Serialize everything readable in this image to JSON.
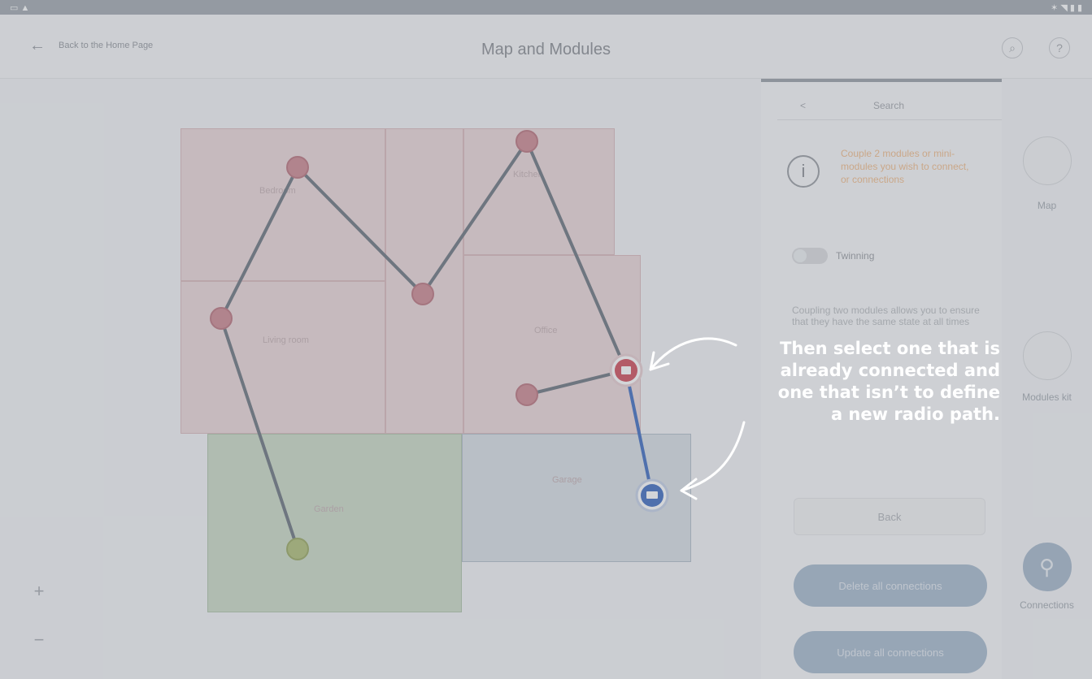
{
  "header": {
    "back_label": "Back to the Home Page",
    "title": "Map and Modules",
    "help_icon": "question-icon",
    "search_icon": "magnifier-icon"
  },
  "panel": {
    "tab_label": "Search",
    "tab_chevron": "<",
    "info_icon": "i",
    "warning_text": "Couple 2 modules or mini-modules you wish to connect, or connections",
    "toggle_label": "Twinning",
    "coupling_text": "Coupling two modules allows you to ensure that they have the same state at all times",
    "back_button": "Back",
    "delete_all_button": "Delete all connections",
    "update_all_button": "Update all connections"
  },
  "rail": {
    "map_label": "Map",
    "modules_label": "Modules kit",
    "connections_label": "Connections"
  },
  "map": {
    "zoom_in": "+",
    "zoom_out": "−",
    "rooms": [
      {
        "label": "Bedroom"
      },
      {
        "label": "Living room"
      },
      {
        "label": "Kitchen"
      },
      {
        "label": "Office"
      },
      {
        "label": "Garden"
      },
      {
        "label": "Garage"
      }
    ]
  },
  "tutorial": {
    "lines": [
      "Then select one that is",
      "already connected and",
      "one that isn’t to define",
      "a new radio path."
    ]
  },
  "colors": {
    "room_pink": "#e9c9cb",
    "room_green": "#b9cdb3",
    "room_blue": "#c7d1dd",
    "path": "#6d7580",
    "node_red": "#cc3a4a",
    "node_blue": "#2a5dba",
    "accent_button": "#9fb3c9",
    "warning": "#f1b57f"
  }
}
